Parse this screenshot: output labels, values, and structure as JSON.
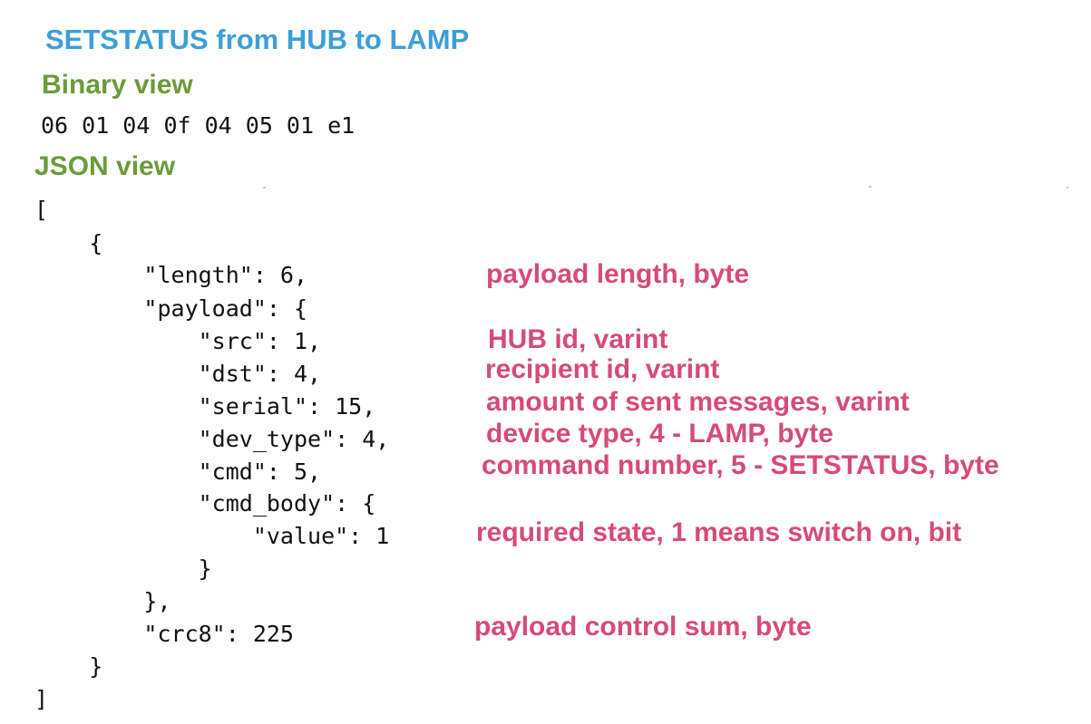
{
  "title": "SETSTATUS from HUB to LAMP",
  "binary_view": {
    "heading": "Binary view",
    "bytes": "06 01 04 0f 04 05 01 e1"
  },
  "json_view": {
    "heading": "JSON view",
    "lines": [
      "[",
      "    {",
      "        \"length\": 6,",
      "        \"payload\": {",
      "            \"src\": 1,",
      "            \"dst\": 4,",
      "            \"serial\": 15,",
      "            \"dev_type\": 4,",
      "            \"cmd\": 5,",
      "            \"cmd_body\": {",
      "                \"value\": 1",
      "            }",
      "        },",
      "        \"crc8\": 225",
      "    }",
      "]"
    ]
  },
  "annotations": {
    "length": "payload length, byte",
    "src": "HUB id, varint",
    "dst": "recipient id, varint",
    "serial": "amount of sent messages, varint",
    "dev_type": "device type, 4 - LAMP, byte",
    "cmd": "command number, 5 - SETSTATUS, byte",
    "value": "required state, 1 means switch on, bit",
    "crc8": "payload control sum, byte"
  },
  "colors": {
    "title": "#3d9fd6",
    "section_heading": "#6b9b3a",
    "annotation": "#d64a7b",
    "code": "#111111"
  }
}
